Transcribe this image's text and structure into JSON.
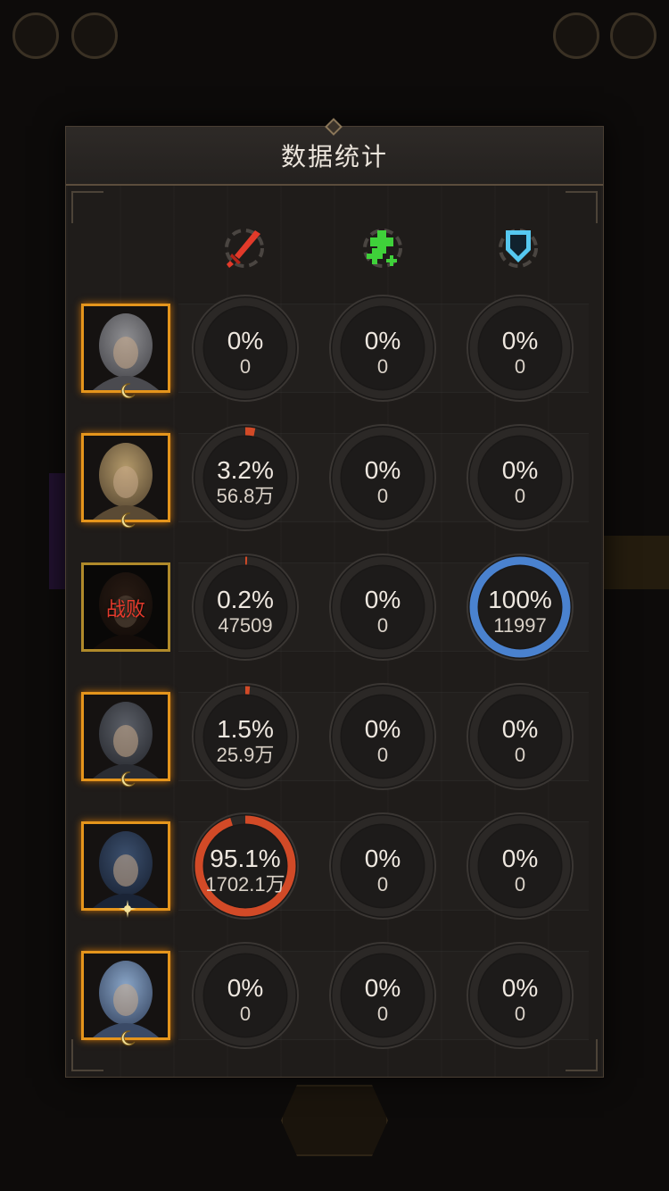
{
  "panel": {
    "title": "数据统计"
  },
  "columns": [
    {
      "name": "damage",
      "icon": "sword-icon",
      "color": "#e23a2a"
    },
    {
      "name": "healing",
      "icon": "heal-plus-icon",
      "color": "#3fd13a"
    },
    {
      "name": "defense",
      "icon": "shield-icon",
      "color": "#56c8f0"
    }
  ],
  "ring_colors": {
    "damage": "#d24a27",
    "healing": "#3fd13a",
    "defense": "#4a82cf",
    "track": "#2b2826"
  },
  "heroes": [
    {
      "name": "hero-1",
      "defeated": false,
      "badge": "moon",
      "damage": {
        "pct": "0%",
        "amount": "0",
        "fraction": 0
      },
      "healing": {
        "pct": "0%",
        "amount": "0",
        "fraction": 0
      },
      "defense": {
        "pct": "0%",
        "amount": "0",
        "fraction": 0
      }
    },
    {
      "name": "hero-2",
      "defeated": false,
      "badge": "moon",
      "damage": {
        "pct": "3.2%",
        "amount": "56.8万",
        "fraction": 0.032
      },
      "healing": {
        "pct": "0%",
        "amount": "0",
        "fraction": 0
      },
      "defense": {
        "pct": "0%",
        "amount": "0",
        "fraction": 0
      }
    },
    {
      "name": "hero-3",
      "defeated": true,
      "defeat_label": "战败",
      "badge": "none",
      "damage": {
        "pct": "0.2%",
        "amount": "47509",
        "fraction": 0.002
      },
      "healing": {
        "pct": "0%",
        "amount": "0",
        "fraction": 0
      },
      "defense": {
        "pct": "100%",
        "amount": "11997",
        "fraction": 1
      }
    },
    {
      "name": "hero-4",
      "defeated": false,
      "badge": "moon",
      "damage": {
        "pct": "1.5%",
        "amount": "25.9万",
        "fraction": 0.015
      },
      "healing": {
        "pct": "0%",
        "amount": "0",
        "fraction": 0
      },
      "defense": {
        "pct": "0%",
        "amount": "0",
        "fraction": 0
      }
    },
    {
      "name": "hero-5",
      "defeated": false,
      "badge": "sun",
      "damage": {
        "pct": "95.1%",
        "amount": "1702.1万",
        "fraction": 0.951
      },
      "healing": {
        "pct": "0%",
        "amount": "0",
        "fraction": 0
      },
      "defense": {
        "pct": "0%",
        "amount": "0",
        "fraction": 0
      }
    },
    {
      "name": "hero-6",
      "defeated": false,
      "badge": "moon",
      "damage": {
        "pct": "0%",
        "amount": "0",
        "fraction": 0
      },
      "healing": {
        "pct": "0%",
        "amount": "0",
        "fraction": 0
      },
      "defense": {
        "pct": "0%",
        "amount": "0",
        "fraction": 0
      }
    }
  ]
}
